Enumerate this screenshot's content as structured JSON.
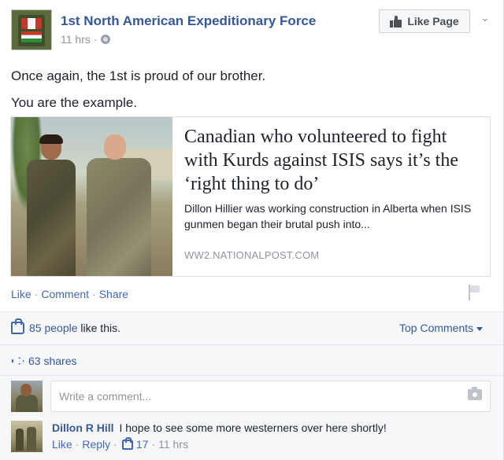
{
  "post": {
    "page_name": "1st North American Expeditionary Force",
    "time": "11 hrs",
    "meta_sep": "·",
    "like_page_label": "Like Page",
    "text_lines": [
      "Once again, the 1st is proud of our brother.",
      "You are the example."
    ]
  },
  "link": {
    "title": "Canadian who volunteered to fight with Kurds against ISIS says it’s the ‘right thing to do’",
    "description": "Dillon Hillier was working construction in Alberta when ISIS gunmen began their brutal push into...",
    "domain": "WW2.NATIONALPOST.COM"
  },
  "actions": {
    "like": "Like",
    "comment": "Comment",
    "share": "Share",
    "sep": "·"
  },
  "feedback": {
    "likes_count": "85 people",
    "likes_suffix": "like this.",
    "top_comments_label": "Top Comments",
    "shares": "63 shares",
    "comment_placeholder": "Write a comment..."
  },
  "comment": {
    "author": "Dillon R Hill",
    "text": "I hope to see some more westerners over here shortly!",
    "like": "Like",
    "reply": "Reply",
    "likes": "17",
    "time": "11 hrs",
    "sep": "·"
  },
  "colors": {
    "link_blue": "#365899",
    "action_blue": "#4267b2",
    "meta_gray": "#90949c",
    "feedback_bg": "#f6f7f9"
  },
  "icons": [
    "globe-icon",
    "thumbs-up-icon",
    "chevron-down-icon",
    "flag-icon",
    "like-outline-icon",
    "share-arrow-icon",
    "camera-icon",
    "caret-down-icon"
  ]
}
